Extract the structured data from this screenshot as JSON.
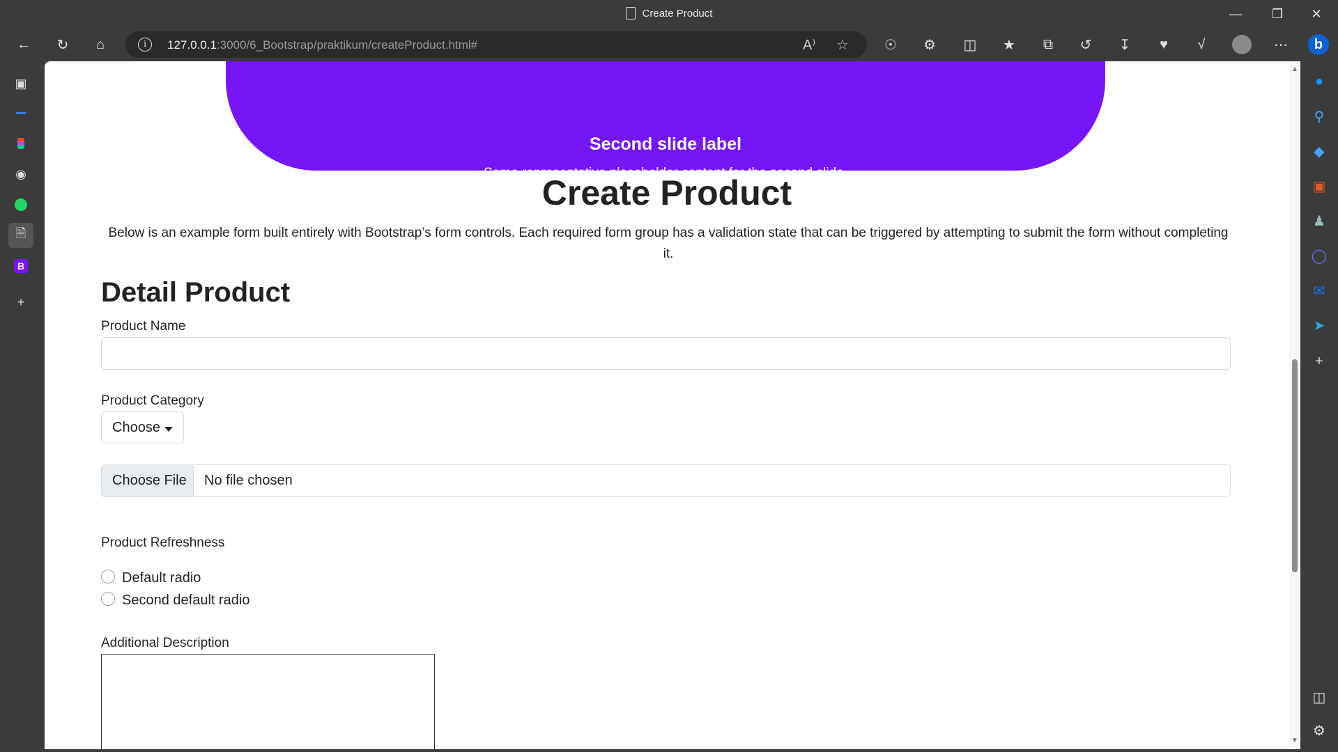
{
  "window": {
    "title": "Create Product",
    "controls": [
      "minimize",
      "restore",
      "close"
    ]
  },
  "toolbar": {
    "url_host": "127.0.0.1",
    "url_rest": ":3000/6_Bootstrap/praktikum/createProduct.html#",
    "info_glyph": "i",
    "read_aloud_glyph": "A⁾"
  },
  "left_tabs": [
    {
      "name": "tab-actions"
    },
    {
      "name": "tab-site-a"
    },
    {
      "name": "tab-figma"
    },
    {
      "name": "tab-github"
    },
    {
      "name": "tab-whatsapp"
    },
    {
      "name": "tab-create-product",
      "active": true
    },
    {
      "name": "tab-bootstrap",
      "label": "B"
    }
  ],
  "carousel": {
    "label": "Second slide label",
    "text": "Some representative placeholder content for the second slide.",
    "indicators": 3,
    "active_index": 1,
    "color": "#7615f5"
  },
  "content": {
    "heading": "Create Product",
    "intro": "Below is an example form built entirely with Bootstrap’s form controls. Each required form group has a validation state that can be triggered by attempting to submit the form without completing it.",
    "section_title": "Detail Product",
    "product_name": {
      "label": "Product Name",
      "value": ""
    },
    "product_category": {
      "label": "Product Category",
      "selected": "Choose"
    },
    "file": {
      "button": "Choose File",
      "status": "No file chosen"
    },
    "freshness": {
      "label": "Product Refreshness",
      "options": [
        "Default radio",
        "Second default radio"
      ]
    },
    "description": {
      "label": "Additional Description",
      "value": ""
    }
  }
}
